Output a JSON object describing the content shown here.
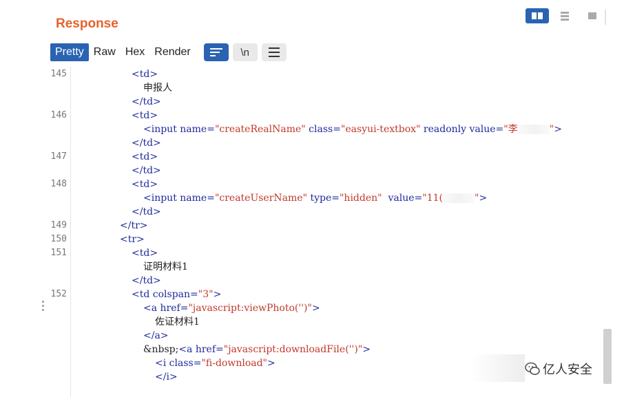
{
  "panel": {
    "title": "Response"
  },
  "layout_toggle": [
    {
      "icon": "split-columns-icon",
      "active": true
    },
    {
      "icon": "split-rows-icon",
      "active": false
    },
    {
      "icon": "single-pane-icon",
      "active": false
    }
  ],
  "tabs": [
    {
      "label": "Pretty",
      "active": true
    },
    {
      "label": "Raw",
      "active": false
    },
    {
      "label": "Hex",
      "active": false
    },
    {
      "label": "Render",
      "active": false
    }
  ],
  "tools": {
    "wrap_icon": "word-wrap-icon",
    "newline_label": "\\n",
    "menu_icon": "hamburger-menu-icon"
  },
  "code_lines": [
    {
      "num": "145",
      "segments": [
        [
          "tag",
          "<td>"
        ]
      ],
      "indent": 5
    },
    {
      "num": "",
      "segments": [
        [
          "text",
          "申报人"
        ]
      ],
      "indent": 6
    },
    {
      "num": "",
      "segments": [
        [
          "tag",
          "</td>"
        ]
      ],
      "indent": 5
    },
    {
      "num": "146",
      "segments": [
        [
          "tag",
          "<td>"
        ]
      ],
      "indent": 5
    },
    {
      "num": "",
      "segments": [
        [
          "tag",
          "<input "
        ],
        [
          "attr",
          "name="
        ],
        [
          "val",
          "\"createRealName\""
        ],
        [
          "attr",
          " class="
        ],
        [
          "val",
          "\"easyui-textbox\""
        ],
        [
          "attr",
          " readonly value="
        ],
        [
          "val",
          "\"李"
        ],
        [
          "blur",
          ""
        ],
        [
          "val",
          "\""
        ],
        [
          "tag",
          ">"
        ]
      ],
      "indent": 6
    },
    {
      "num": "",
      "segments": [
        [
          "tag",
          "</td>"
        ]
      ],
      "indent": 5
    },
    {
      "num": "147",
      "segments": [
        [
          "tag",
          "<td>"
        ]
      ],
      "indent": 5
    },
    {
      "num": "",
      "segments": [
        [
          "tag",
          "</td>"
        ]
      ],
      "indent": 5
    },
    {
      "num": "148",
      "segments": [
        [
          "tag",
          "<td>"
        ]
      ],
      "indent": 5
    },
    {
      "num": "",
      "segments": [
        [
          "tag",
          "<input "
        ],
        [
          "attr",
          "name="
        ],
        [
          "val",
          "\"createUserName\""
        ],
        [
          "attr",
          " type="
        ],
        [
          "val",
          "\"hidden\""
        ],
        [
          "attr",
          "  value="
        ],
        [
          "val",
          "\"11("
        ],
        [
          "blur",
          ""
        ],
        [
          "val",
          "\""
        ],
        [
          "tag",
          ">"
        ]
      ],
      "indent": 6
    },
    {
      "num": "",
      "segments": [
        [
          "tag",
          "</td>"
        ]
      ],
      "indent": 5
    },
    {
      "num": "149",
      "segments": [
        [
          "tag",
          "</tr>"
        ]
      ],
      "indent": 4
    },
    {
      "num": "150",
      "segments": [
        [
          "tag",
          "<tr>"
        ]
      ],
      "indent": 4
    },
    {
      "num": "151",
      "segments": [
        [
          "tag",
          "<td>"
        ]
      ],
      "indent": 5
    },
    {
      "num": "",
      "segments": [
        [
          "text",
          "证明材料1"
        ]
      ],
      "indent": 6
    },
    {
      "num": "",
      "segments": [
        [
          "tag",
          "</td>"
        ]
      ],
      "indent": 5
    },
    {
      "num": "152",
      "segments": [
        [
          "tag",
          "<td "
        ],
        [
          "attr",
          "colspan="
        ],
        [
          "val",
          "\"3\""
        ],
        [
          "tag",
          ">"
        ]
      ],
      "indent": 5
    },
    {
      "num": "",
      "segments": [
        [
          "tag",
          "<a "
        ],
        [
          "attr",
          "href="
        ],
        [
          "val",
          "\"javascript:viewPhoto('')\""
        ],
        [
          "tag",
          ">"
        ]
      ],
      "indent": 6
    },
    {
      "num": "",
      "segments": [
        [
          "text",
          "佐证材料1"
        ]
      ],
      "indent": 7
    },
    {
      "num": "",
      "segments": [
        [
          "tag",
          "</a>"
        ]
      ],
      "indent": 6
    },
    {
      "num": "",
      "segments": [
        [
          "text",
          "&nbsp;"
        ],
        [
          "tag",
          "<a "
        ],
        [
          "attr",
          "href="
        ],
        [
          "val",
          "\"javascript:downloadFile('')\""
        ],
        [
          "tag",
          ">"
        ]
      ],
      "indent": 6
    },
    {
      "num": "",
      "segments": [
        [
          "tag",
          "<i "
        ],
        [
          "attr",
          "class="
        ],
        [
          "val",
          "\"fi-download\""
        ],
        [
          "tag",
          ">"
        ]
      ],
      "indent": 7
    },
    {
      "num": "",
      "segments": [
        [
          "tag",
          "</i>"
        ]
      ],
      "indent": 7
    }
  ],
  "watermark": {
    "text": "亿人安全",
    "logo_icon": "wechat-logo-icon"
  }
}
